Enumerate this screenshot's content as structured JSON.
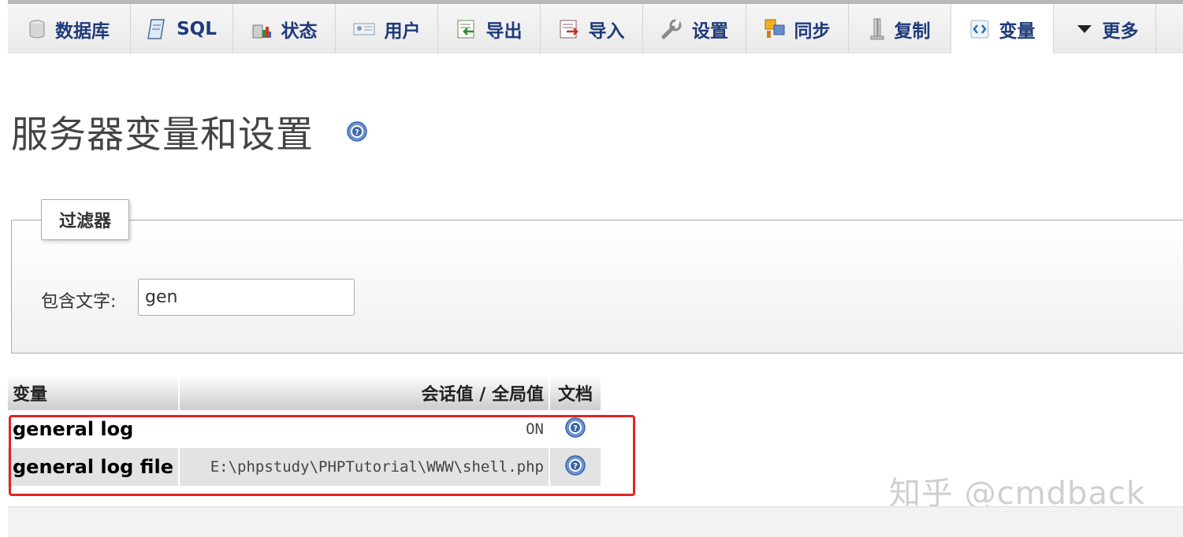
{
  "nav": {
    "tabs": [
      {
        "label": "数据库",
        "icon": "database-icon"
      },
      {
        "label": "SQL",
        "icon": "sql-icon"
      },
      {
        "label": "状态",
        "icon": "status-icon"
      },
      {
        "label": "用户",
        "icon": "users-icon"
      },
      {
        "label": "导出",
        "icon": "export-icon"
      },
      {
        "label": "导入",
        "icon": "import-icon"
      },
      {
        "label": "设置",
        "icon": "settings-icon"
      },
      {
        "label": "同步",
        "icon": "sync-icon"
      },
      {
        "label": "复制",
        "icon": "replication-icon"
      },
      {
        "label": "变量",
        "icon": "variables-icon",
        "active": true
      },
      {
        "label": "更多",
        "icon": "chevron-down-icon"
      }
    ]
  },
  "page": {
    "title": "服务器变量和设置"
  },
  "filter": {
    "legend": "过滤器",
    "label": "包含文字:",
    "value": "gen"
  },
  "table": {
    "headers": {
      "variable": "变量",
      "value": "会话值 / 全局值",
      "doc": "文档"
    },
    "rows": [
      {
        "name": "general log",
        "value": "ON"
      },
      {
        "name": "general log file",
        "value": "E:\\phpstudy\\PHPTutorial\\WWW\\shell.php"
      }
    ]
  },
  "watermark": "知乎 @cmdback",
  "colors": {
    "accent": "#1e3a7a",
    "highlight": "#e0241f",
    "row_alt": "#e3e3e3"
  }
}
